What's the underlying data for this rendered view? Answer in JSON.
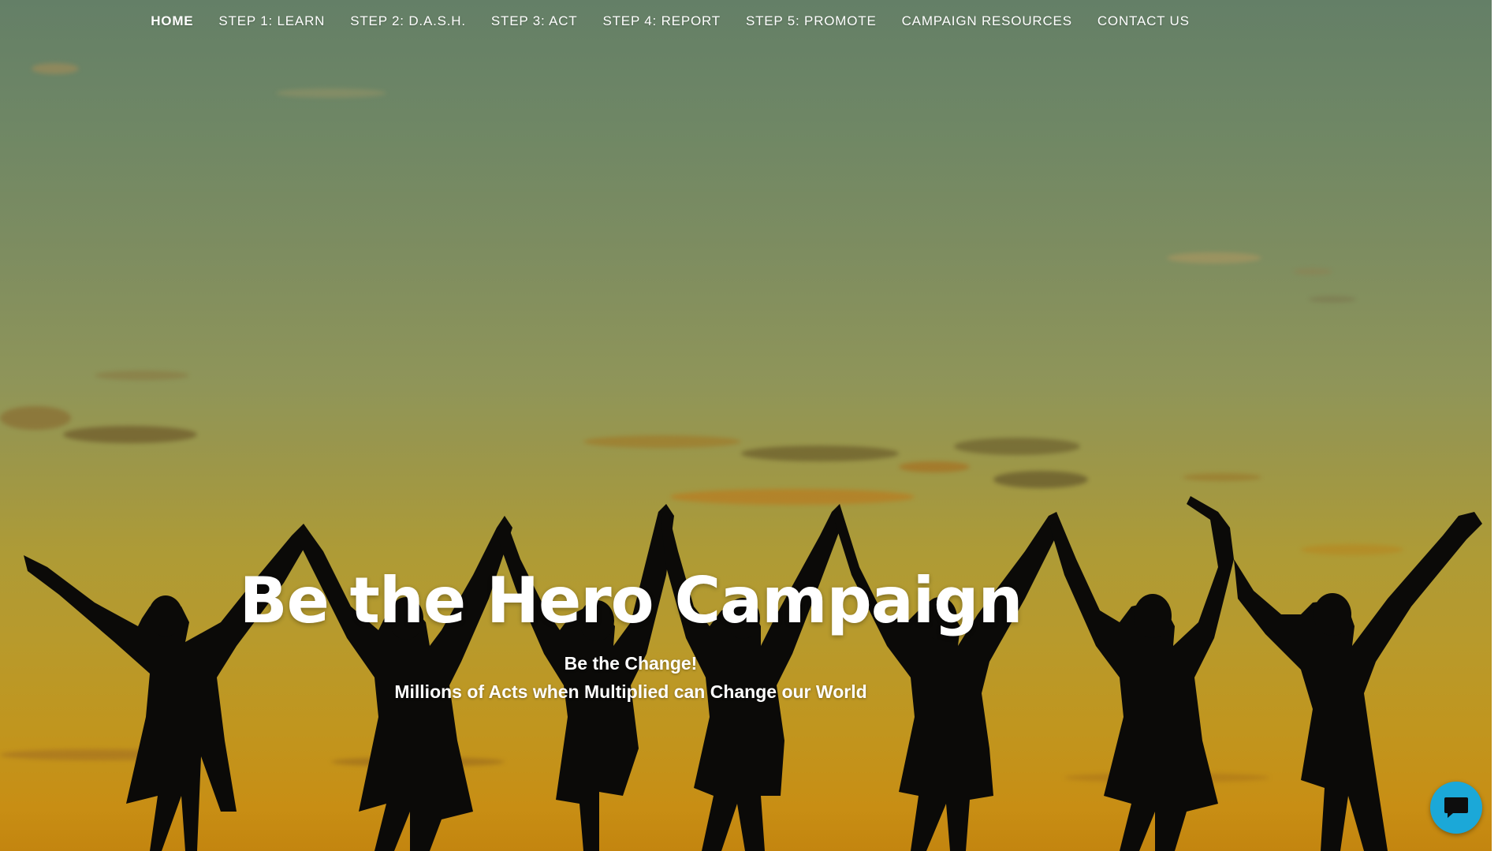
{
  "nav": {
    "items": [
      {
        "label": "HOME",
        "active": true
      },
      {
        "label": "STEP 1: LEARN",
        "active": false
      },
      {
        "label": "STEP 2: D.A.S.H.",
        "active": false
      },
      {
        "label": "STEP 3: ACT",
        "active": false
      },
      {
        "label": "STEP 4: REPORT",
        "active": false
      },
      {
        "label": "STEP 5: PROMOTE",
        "active": false
      },
      {
        "label": "CAMPAIGN RESOURCES",
        "active": false
      },
      {
        "label": "CONTACT US",
        "active": false
      }
    ]
  },
  "hero": {
    "title": "Be the Hero Campaign",
    "subtitle_line1": "Be the Change!",
    "subtitle_line2": "Millions of Acts when Multiplied can Change our World",
    "background": "sunset-silhouettes-image"
  },
  "chat": {
    "icon": "chat-bubble-icon",
    "color": "#1ba8d8"
  }
}
